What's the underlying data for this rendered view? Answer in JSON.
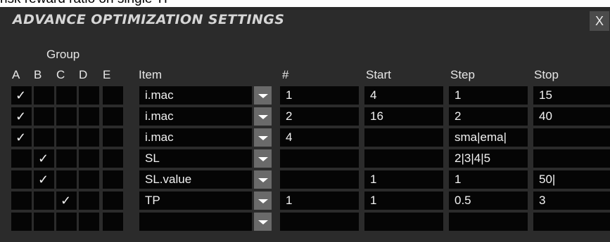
{
  "background_caption": "risk reward ratio on single TF",
  "dialog": {
    "title": "ADVANCE OPTIMIZATION SETTINGS",
    "close_label": "X"
  },
  "group_label": "Group",
  "headers": {
    "A": "A",
    "B": "B",
    "C": "C",
    "D": "D",
    "E": "E",
    "item": "Item",
    "num": "#",
    "start": "Start",
    "step": "Step",
    "stop": "Stop"
  },
  "rows": [
    {
      "checks": [
        "✓",
        "",
        "",
        "",
        ""
      ],
      "item": "i.mac",
      "num": "1",
      "start": "4",
      "step": "1",
      "stop": "15"
    },
    {
      "checks": [
        "✓",
        "",
        "",
        "",
        ""
      ],
      "item": "i.mac",
      "num": "2",
      "start": "16",
      "step": "2",
      "stop": "40"
    },
    {
      "checks": [
        "✓",
        "",
        "",
        "",
        ""
      ],
      "item": "i.mac",
      "num": "4",
      "start": "",
      "step": "sma|ema|",
      "stop": ""
    },
    {
      "checks": [
        "",
        "✓",
        "",
        "",
        ""
      ],
      "item": "SL",
      "num": "",
      "start": "",
      "step": "2|3|4|5",
      "stop": ""
    },
    {
      "checks": [
        "",
        "✓",
        "",
        "",
        ""
      ],
      "item": "SL.value",
      "num": "",
      "start": "1",
      "step": "1",
      "stop": "50|"
    },
    {
      "checks": [
        "",
        "",
        "✓",
        "",
        ""
      ],
      "item": "TP",
      "num": "1",
      "start": "1",
      "step": "0.5",
      "stop": "3"
    },
    {
      "checks": [
        "",
        "",
        "",
        "",
        ""
      ],
      "item": "",
      "num": "",
      "start": "",
      "step": "",
      "stop": ""
    }
  ],
  "colors": {
    "dialog_bg": "#2b2b2b",
    "cell_bg": "#050505",
    "dropdown_bg": "#6a6a6a",
    "text": "#f2f2f2",
    "title": "#d6d6d6"
  }
}
